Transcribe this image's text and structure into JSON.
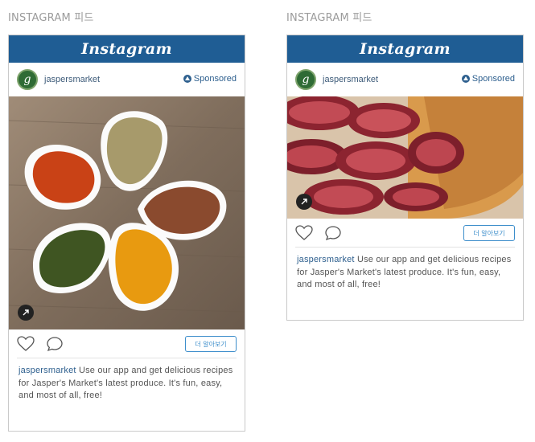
{
  "section_label": "INSTAGRAM 피드",
  "ig_logo": "Instagram",
  "avatar_letter": "g",
  "username": "jaspersmarket",
  "sponsored_label": "Sponsored",
  "cta_label": "더 알아보기",
  "caption": {
    "user": "jaspersmarket",
    "text": " Use our app and get delicious recipes for Jasper's Market's latest produce. It's fun, easy, and most of all, free!"
  },
  "cards": [
    {
      "image": "spices-photo"
    },
    {
      "image": "fig-tart-photo"
    }
  ],
  "colors": {
    "header_blue": "#1f5d94",
    "link_blue": "#2d5f8e",
    "cta_blue": "#3d8ecb"
  },
  "icons": [
    "sponsored-icon",
    "external-link-icon",
    "heart-icon",
    "comment-icon"
  ]
}
